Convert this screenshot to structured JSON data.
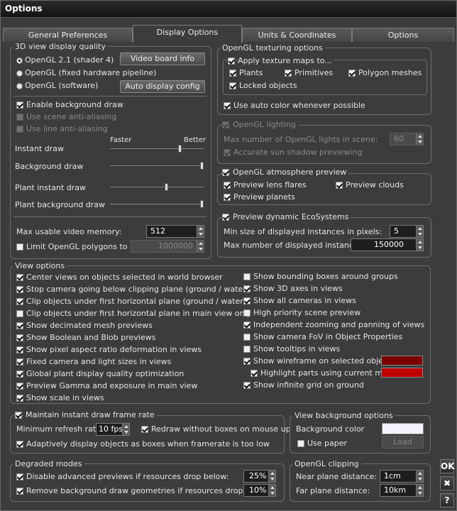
{
  "window": {
    "title": "Options"
  },
  "tabs": [
    "General Preferences",
    "Display Options",
    "Units & Coordinates",
    "Options"
  ],
  "quality": {
    "title": "3D view display quality",
    "radio1": "OpenGL 2.1 (shader 4)",
    "radio2": "OpenGL (fixed hardware pipeline)",
    "radio3": "OpenGL (software)",
    "video_info": "Video board info",
    "auto_config": "Auto display config",
    "enable_bg": "Enable background draw",
    "scene_aa": "Use scene anti-aliasing",
    "line_aa": "Use line anti-aliasing",
    "faster": "Faster",
    "better": "Better",
    "instant": "Instant draw",
    "background": "Background draw",
    "plant_instant": "Plant instant draw",
    "plant_background": "Plant background draw",
    "max_mem_label": "Max usable video memory:",
    "max_mem": "512",
    "limit_label": "Limit OpenGL polygons to",
    "limit_value": "1000000"
  },
  "texturing": {
    "title": "OpenGL texturing options",
    "apply": "Apply texture maps to...",
    "plants": "Plants",
    "primitives": "Primitives",
    "polygon": "Polygon meshes",
    "locked": "Locked objects",
    "auto_color": "Use auto color whenever possible"
  },
  "lighting": {
    "title": "OpenGL lighting",
    "max_lights": "Max number of OpenGL lights in scene:",
    "max_lights_value": "60",
    "sun_shadow": "Accurate sun shadow previewing"
  },
  "atmosphere": {
    "title": "OpenGL atmosphere preview",
    "flares": "Preview lens flares",
    "clouds": "Preview clouds",
    "planets": "Preview planets"
  },
  "eco": {
    "title": "Preview dynamic EcoSystems",
    "min_size_label": "Min size of displayed instances in pixels:",
    "min_size": "5",
    "max_num_label": "Max number of displayed instances:",
    "max_num": "150000"
  },
  "view": {
    "title": "View options",
    "left": [
      "Center views on objects selected in world browser",
      "Stop camera going below clipping plane (ground / water)",
      "Clip objects under first horizontal plane (ground / water)",
      "Clip objects under first horizontal plane in main view only",
      "Show decimated mesh previews",
      "Show Boolean and Blob previews",
      "Show pixel aspect ratio deformation in views",
      "Fixed camera and light sizes in views",
      "Global plant display quality optimization",
      "Preview Gamma and exposure in main view",
      "Show scale in views"
    ],
    "right": [
      "Show bounding boxes around groups",
      "Show 3D axes in views",
      "Show all cameras in views",
      "High priority scene preview",
      "Independent zooming and panning of views",
      "Show camera FoV in Object Properties",
      "Show tooltips in views",
      "Show wireframe on selected objects",
      "Highlight parts using current material",
      "Show infinite grid on ground"
    ],
    "wire_color": "#7a0000",
    "highlight_color": "#c00000"
  },
  "framerate": {
    "title": "Maintain instant draw frame rate",
    "min_refresh": "Minimum refresh rate:",
    "fps": "10 fps",
    "redraw": "Redraw without boxes on mouse up",
    "adaptive": "Adaptively display objects as boxes when framerate is too low"
  },
  "bgopts": {
    "title": "View background options",
    "bg_color": "Background color",
    "use_paper": "Use paper",
    "load": "Load",
    "color": "#f4f4ff"
  },
  "degraded": {
    "title": "Degraded modes",
    "disable": "Disable advanced previews if resources drop below:",
    "disable_val": "25%",
    "remove": "Remove background draw geometries if resources drop below:",
    "remove_val": "10%"
  },
  "clipping": {
    "title": "OpenGL clipping",
    "near": "Near plane distance:",
    "near_val": "1cm",
    "far": "Far plane distance:",
    "far_val": "10km"
  },
  "side": {
    "ok": "OK",
    "close": "✖",
    "help": "?"
  }
}
